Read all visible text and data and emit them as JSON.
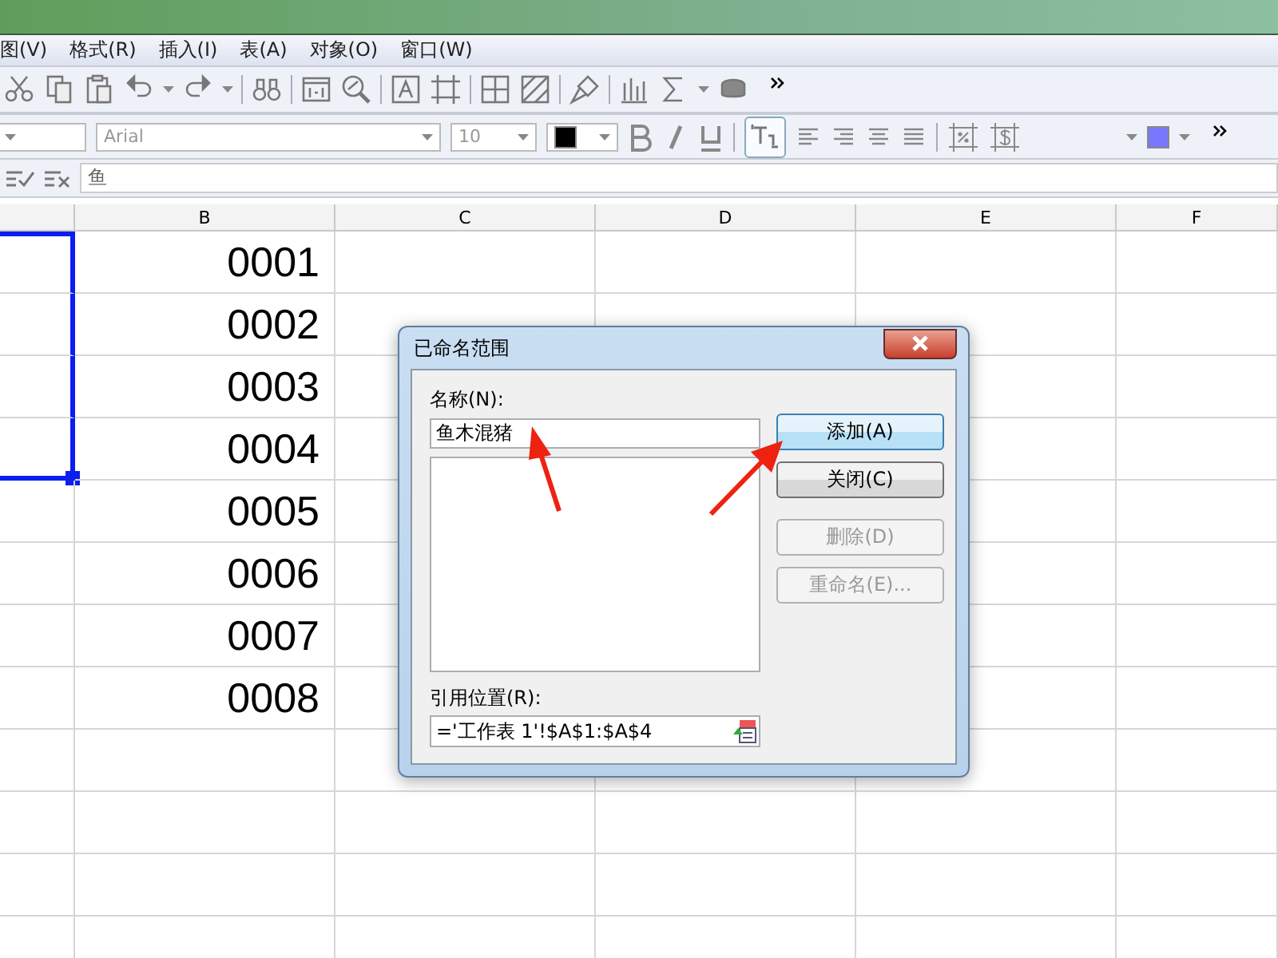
{
  "menu": [
    {
      "label": "图(V)"
    },
    {
      "label": "格式(R)"
    },
    {
      "label": "插入(I)"
    },
    {
      "label": "表(A)"
    },
    {
      "label": "对象(O)"
    },
    {
      "label": "窗口(W)"
    }
  ],
  "format_bar": {
    "font": "Arial",
    "size": "10",
    "text_frame_selected": true
  },
  "formula_bar": {
    "value": "鱼"
  },
  "sheet": {
    "columns": [
      "B",
      "C",
      "D",
      "E",
      "F"
    ],
    "rows": [
      {
        "value": "0001",
        "selected": true
      },
      {
        "value": "0002",
        "selected": true
      },
      {
        "value": "0003",
        "selected": true
      },
      {
        "value": "0004",
        "selected": true
      },
      {
        "value": "0005",
        "selected": false
      },
      {
        "value": "0006",
        "selected": false
      },
      {
        "value": "0007",
        "selected": false
      },
      {
        "value": "0008",
        "selected": false
      },
      {
        "selected": false
      },
      {
        "selected": false
      },
      {
        "selected": false
      },
      {
        "selected": false
      }
    ]
  },
  "dialog": {
    "title": "已命名范围",
    "name_label": "名称(N):",
    "name_value": "鱼木混猪",
    "ref_label": "引用位置(R):",
    "ref_value": "='工作表 1'!$A$1:$A$4",
    "buttons": [
      {
        "label": "添加(A)",
        "default": true,
        "disabled": false
      },
      {
        "label": "关闭(C)",
        "default": false,
        "disabled": false
      },
      {
        "label": "删除(D)",
        "default": false,
        "disabled": true
      },
      {
        "label": "重命名(E)...",
        "default": false,
        "disabled": true
      }
    ]
  }
}
